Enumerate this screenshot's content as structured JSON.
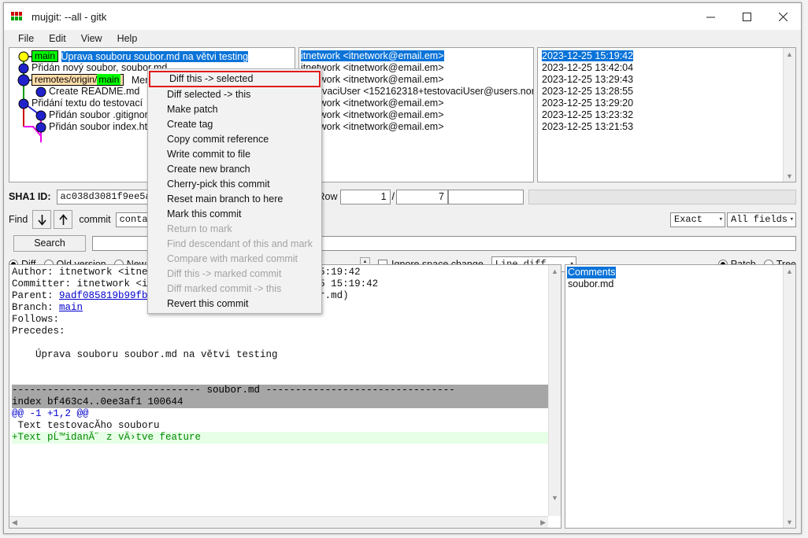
{
  "window": {
    "title": "mujgit: --all - gitk",
    "icon": "gitk-icon",
    "controls": {
      "minimize": "minimize-icon",
      "maximize": "maximize-icon",
      "close": "close-icon"
    }
  },
  "menubar": {
    "items": [
      "File",
      "Edit",
      "View",
      "Help"
    ]
  },
  "commits": {
    "rows": [
      {
        "refs": [
          {
            "text": "main",
            "style": "green"
          }
        ],
        "subject": "Úprava souboru soubor.md na větvi testing",
        "selected": true,
        "author": "itnetwork <itnetwork@email.em>",
        "date": "2023-12-25 15:19:42"
      },
      {
        "refs": [],
        "subject": "Přidán nový soubor, soubor.md",
        "selected": false,
        "author": "itnetwork <itnetwork@email.em>",
        "date": "2023-12-25 13:42:04"
      },
      {
        "refs": [
          {
            "text": "remotes/origin/",
            "style": "tan"
          },
          {
            "text": "main",
            "style": "green"
          }
        ],
        "subject": "Merge branch 'testing'",
        "selected": false,
        "author": "itnetwork <itnetwork@email.em>",
        "date": "2023-12-25 13:29:43"
      },
      {
        "refs": [],
        "subject": "Create README.md",
        "selected": false,
        "author": "testovaciUser <152162318+testovaciUser@users.nor",
        "date": "2023-12-25 13:28:55"
      },
      {
        "refs": [],
        "subject": "Přidání textu do testovací",
        "selected": false,
        "author": "itnetwork <itnetwork@email.em>",
        "date": "2023-12-25 13:29:20"
      },
      {
        "refs": [],
        "subject": "Přidán soubor .gitignore",
        "selected": false,
        "author": "itnetwork <itnetwork@email.em>",
        "date": "2023-12-25 13:23:32"
      },
      {
        "refs": [],
        "subject": "Přidán soubor index.html",
        "selected": false,
        "author": "itnetwork <itnetwork@email.em>",
        "date": "2023-12-25 13:21:53"
      }
    ]
  },
  "contextmenu": {
    "items": [
      {
        "label": "Diff this -> selected",
        "enabled": true,
        "highlighted": true
      },
      {
        "label": "Diff selected -> this",
        "enabled": true,
        "highlighted": false
      },
      {
        "label": "Make patch",
        "enabled": true,
        "highlighted": false
      },
      {
        "label": "Create tag",
        "enabled": true,
        "highlighted": false
      },
      {
        "label": "Copy commit reference",
        "enabled": true,
        "highlighted": false
      },
      {
        "label": "Write commit to file",
        "enabled": true,
        "highlighted": false
      },
      {
        "label": "Create new branch",
        "enabled": true,
        "highlighted": false
      },
      {
        "label": "Cherry-pick this commit",
        "enabled": true,
        "highlighted": false
      },
      {
        "label": "Reset main branch to here",
        "enabled": true,
        "highlighted": false
      },
      {
        "label": "Mark this commit",
        "enabled": true,
        "highlighted": false
      },
      {
        "label": "Return to mark",
        "enabled": false,
        "highlighted": false
      },
      {
        "label": "Find descendant of this and mark",
        "enabled": false,
        "highlighted": false
      },
      {
        "label": "Compare with marked commit",
        "enabled": false,
        "highlighted": false
      },
      {
        "label": "Diff this -> marked commit",
        "enabled": false,
        "highlighted": false
      },
      {
        "label": "Diff marked commit -> this",
        "enabled": false,
        "highlighted": false
      },
      {
        "label": "Revert this commit",
        "enabled": true,
        "highlighted": false
      }
    ]
  },
  "sha_row": {
    "label": "SHA1 ID:",
    "value": "ac038d3081f9ee5a",
    "row_label": "Row",
    "row_current": "1",
    "row_separator": "/",
    "row_total": "7"
  },
  "find_row": {
    "label": "Find",
    "down_icon": "arrow-down-icon",
    "up_icon": "arrow-up-icon",
    "commit_label": "commit",
    "containing_value": "contai",
    "exact_value": "Exact",
    "fields_value": "All fields"
  },
  "search_row": {
    "button": "Search",
    "input_value": ""
  },
  "diff_controls": {
    "mode_options": [
      "Diff",
      "Old version",
      "New"
    ],
    "mode_selected": "Diff",
    "ignore_space_label": "Ignore space change",
    "ignore_space_checked": false,
    "linediff_value": "Line diff"
  },
  "commit_details": {
    "lines": [
      {
        "text": "Author: itnetwork <itnetwork@email.em>  2023-12-25 15:19:42",
        "type": "plain"
      },
      {
        "text": "Committer: itnetwork <itnetwork@email.em>  2023-12-25 15:19:42",
        "type": "plain"
      },
      {
        "text": "Parent: 9adf085819b99fbcb (Přidán nový soubor, soubor.md)",
        "type": "parent",
        "link": "9adf085819b99fbcb"
      },
      {
        "text": "Branch: main",
        "type": "branch",
        "link": "main"
      },
      {
        "text": "Follows:",
        "type": "plain"
      },
      {
        "text": "Precedes:",
        "type": "plain"
      },
      {
        "text": "",
        "type": "plain"
      },
      {
        "text": "    Úprava souboru soubor.md na větvi testing",
        "type": "plain"
      },
      {
        "text": "",
        "type": "plain"
      },
      {
        "text": "",
        "type": "plain"
      },
      {
        "text": "-------------------------------- soubor.md --------------------------------",
        "type": "filehdr"
      },
      {
        "text": "index bf463c4..0ee3af1 100644",
        "type": "filehdr"
      },
      {
        "text": "@@ -1 +1,2 @@",
        "type": "hunk"
      },
      {
        "text": " Text testovacĂ­ho souboru",
        "type": "plain"
      },
      {
        "text": "+Text pĹ™idanĂ˝ z vÄ›tve feature",
        "type": "added"
      }
    ]
  },
  "file_panel": {
    "patch_label": "Patch",
    "tree_label": "Tree",
    "selected_mode": "Patch",
    "files": [
      {
        "name": "Comments",
        "selected": true
      },
      {
        "name": "soubor.md",
        "selected": false
      }
    ]
  },
  "colors": {
    "selection_blue": "#0a73d8",
    "ref_green": "#00ff00",
    "ref_tan": "#ffddaa",
    "highlight_red": "#e01b1b",
    "added_green": "#008800"
  }
}
